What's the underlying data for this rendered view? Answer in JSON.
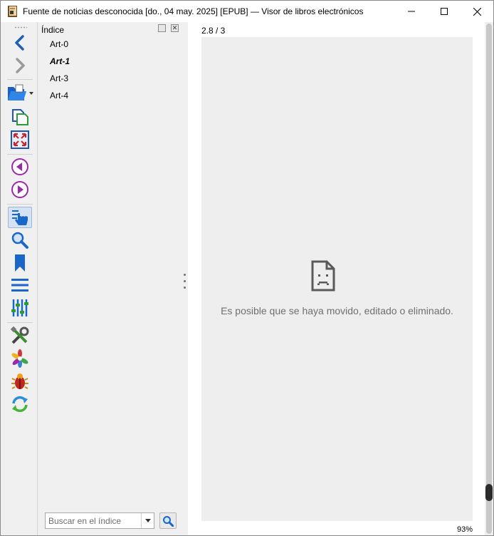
{
  "window": {
    "title": "Fuente de noticias desconocida [do., 04 may. 2025] [EPUB] — Visor de libros electrónicos"
  },
  "toolbar": {
    "buttons": [
      {
        "name": "back",
        "icon": "chevron-left-icon"
      },
      {
        "name": "forward",
        "icon": "chevron-right-icon"
      },
      {
        "name": "open-book",
        "icon": "folder-open-icon"
      },
      {
        "name": "copy",
        "icon": "copy-icon"
      },
      {
        "name": "fullscreen",
        "icon": "fullscreen-icon"
      },
      {
        "name": "previous-page",
        "icon": "circle-arrow-left-icon"
      },
      {
        "name": "next-page",
        "icon": "circle-arrow-right-icon"
      },
      {
        "name": "toc-toggle",
        "icon": "pointer-hand-icon",
        "active": true
      },
      {
        "name": "search",
        "icon": "search-icon"
      },
      {
        "name": "bookmarks",
        "icon": "bookmark-icon"
      },
      {
        "name": "menu",
        "icon": "hamburger-icon"
      },
      {
        "name": "adjust",
        "icon": "sliders-icon"
      },
      {
        "name": "preferences",
        "icon": "tools-icon"
      },
      {
        "name": "plugins",
        "icon": "pinwheel-icon"
      },
      {
        "name": "debug",
        "icon": "bug-icon"
      },
      {
        "name": "reload",
        "icon": "refresh-icon"
      }
    ],
    "colors": {
      "blue": "#1a66c9",
      "purple": "#9b2aa6",
      "green": "#2e9b2e"
    }
  },
  "toc": {
    "title": "Índice",
    "items": [
      {
        "label": "Art-0",
        "current": false
      },
      {
        "label": "Art-1",
        "current": true
      },
      {
        "label": "Art-3",
        "current": false
      },
      {
        "label": "Art-4",
        "current": false
      }
    ],
    "search_placeholder": "Buscar en el índice"
  },
  "viewer": {
    "page_indicator": "2.8 / 3",
    "error_message": "Es posible que se haya movido, editado o eliminado.",
    "zoom": "93%"
  }
}
